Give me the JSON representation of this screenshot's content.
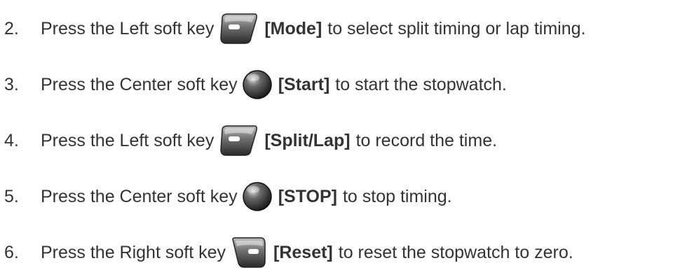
{
  "steps": [
    {
      "number": "2.",
      "prefix": "Press the Left soft key",
      "key_icon": "left-soft-key-icon",
      "label": "[Mode]",
      "suffix": "to select split timing or lap timing."
    },
    {
      "number": "3.",
      "prefix": "Press the Center soft key",
      "key_icon": "center-soft-key-icon",
      "label": "[Start]",
      "suffix": "to start the stopwatch."
    },
    {
      "number": "4.",
      "prefix": "Press the Left soft key",
      "key_icon": "left-soft-key-icon",
      "label": "[Split/Lap]",
      "suffix": "to record the time."
    },
    {
      "number": "5.",
      "prefix": "Press the Center soft key",
      "key_icon": "center-soft-key-icon",
      "label": "[STOP]",
      "suffix": "to stop timing."
    },
    {
      "number": "6.",
      "prefix": "Press the Right soft key",
      "key_icon": "right-soft-key-icon",
      "label": "[Reset]",
      "suffix": "to reset the stopwatch to zero."
    }
  ]
}
